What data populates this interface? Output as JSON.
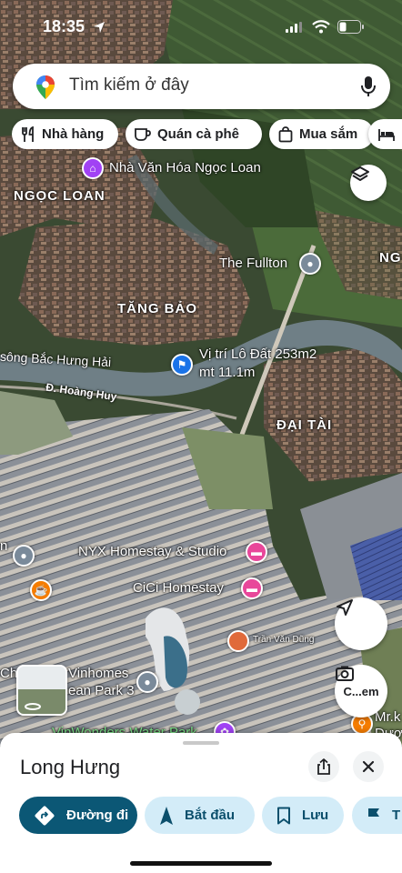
{
  "status_bar": {
    "time": "18:35"
  },
  "search": {
    "placeholder": "Tìm kiếm ở đây"
  },
  "chips": [
    {
      "label": "Nhà hàng",
      "icon": "fork-knife-icon"
    },
    {
      "label": "Quán cà phê",
      "icon": "coffee-cup-icon"
    },
    {
      "label": "Mua sắm",
      "icon": "shopping-bag-icon"
    },
    {
      "label": "",
      "icon": "bed-icon"
    }
  ],
  "map": {
    "areas": [
      "NGỌC LOAN",
      "TĂNG BẢO",
      "ĐẠI TÀI",
      "NG"
    ],
    "places": {
      "cultural_house": "Nhà Văn Hóa Ngọc Loan",
      "fullton": "The Fullton",
      "lot_line1": "Vị trí Lô Đất 253m2",
      "lot_line2": "mt 11.1m",
      "nyx": "NYX Homestay & Studio",
      "cici": "CiCi Homestay",
      "user": "Trần Văn Dũng",
      "vinhomes_line1": "Vinhomes",
      "vinhomes_line2": "ean Park 3",
      "chu": "Chu",
      "mrk_line1": "Mr.k",
      "mrk_line2": "Dượ",
      "vinwonders": "VinWonders Water Park"
    },
    "river": "sông Bắc Hưng Hải",
    "street": "Đ. Hoàng Huy",
    "search_image_label": "C...em"
  },
  "sheet": {
    "title": "Long Hưng",
    "actions": [
      {
        "label": "Đường đi"
      },
      {
        "label": "Bắt đầu"
      },
      {
        "label": "Lưu"
      },
      {
        "label": "T"
      }
    ]
  },
  "colors": {
    "accent_dark": "#0b5775",
    "accent_light": "#d3ecf8",
    "place_blue": "#1a73e8",
    "hotel_pink": "#e8479a",
    "cafe_orange": "#f57c00",
    "culture_purple": "#a142f4"
  }
}
